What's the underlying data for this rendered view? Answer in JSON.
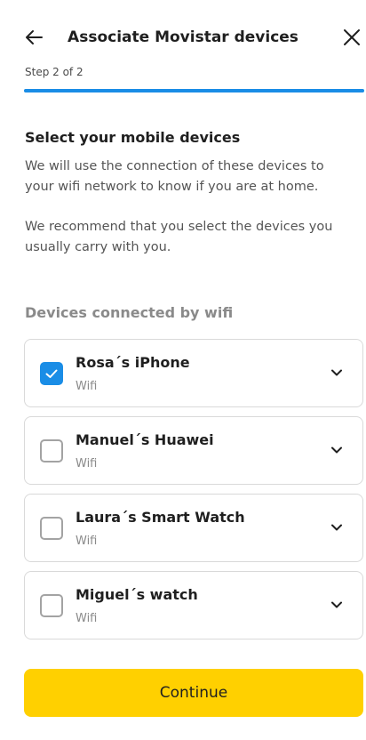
{
  "colors": {
    "accent_blue": "#1a8de6",
    "primary_yellow": "#ffd000",
    "muted_text": "#8a8a8a",
    "card_border": "#d9d9d9"
  },
  "header": {
    "title": "Associate Movistar devices",
    "back_icon": "arrow-left-icon",
    "close_icon": "close-icon",
    "step_label": "Step 2 of 2",
    "progress": 1.0
  },
  "intro": {
    "title": "Select your mobile devices",
    "paragraph_1": "We will use the connection of these devices to your wifi network to know if you are at home.",
    "paragraph_2": "We recommend that you select the devices you usually carry with you."
  },
  "devices": {
    "heading": "Devices connected by wifi",
    "items": [
      {
        "name": "Rosa´s iPhone",
        "type": "Wifi",
        "checked": true
      },
      {
        "name": "Manuel´s Huawei",
        "type": "Wifi",
        "checked": false
      },
      {
        "name": "Laura´s Smart Watch",
        "type": "Wifi",
        "checked": false
      },
      {
        "name": "Miguel´s watch",
        "type": "Wifi",
        "checked": false
      }
    ]
  },
  "footer": {
    "continue_label": "Continue"
  }
}
